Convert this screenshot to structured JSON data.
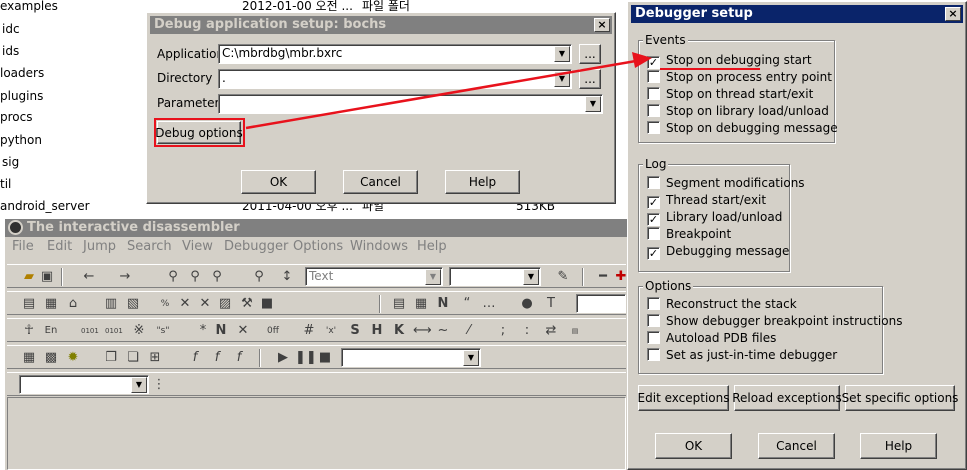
{
  "explorer": {
    "rows": [
      {
        "name": "examples",
        "date": "2012-01-00 오전 ...",
        "type": "파일 폴더",
        "size": ""
      },
      {
        "name": "idc",
        "date": "",
        "type": "",
        "size": ""
      },
      {
        "name": "ids",
        "date": "",
        "type": "",
        "size": ""
      },
      {
        "name": "loaders",
        "date": "",
        "type": "",
        "size": ""
      },
      {
        "name": "plugins",
        "date": "",
        "type": "",
        "size": ""
      },
      {
        "name": "procs",
        "date": "",
        "type": "",
        "size": ""
      },
      {
        "name": "python",
        "date": "",
        "type": "",
        "size": ""
      },
      {
        "name": "sig",
        "date": "",
        "type": "",
        "size": ""
      },
      {
        "name": "til",
        "date": "",
        "type": "",
        "size": ""
      },
      {
        "name": "android_server",
        "date": "2011-04-00 오후 ...",
        "type": "파일",
        "size": "513KB"
      }
    ]
  },
  "debug_app_dialog": {
    "title": "Debug application setup: bochs",
    "close": "×",
    "application_label": "Application",
    "application_value": "C:\\mbrdbg\\mbr.bxrc",
    "directory_label": "Directory",
    "directory_value": ".",
    "parameters_label": "Parameters",
    "parameters_value": "",
    "browse": "...",
    "debug_options": "Debug options",
    "ok": "OK",
    "cancel": "Cancel",
    "help": "Help"
  },
  "debugger_setup": {
    "title": "Debugger setup",
    "close": "×",
    "events": {
      "title": "Events",
      "items": [
        {
          "label": "Stop on debugging start",
          "checked": true
        },
        {
          "label": "Stop on process entry point",
          "checked": false
        },
        {
          "label": "Stop on thread start/exit",
          "checked": false
        },
        {
          "label": "Stop on library load/unload",
          "checked": false
        },
        {
          "label": "Stop on debugging message",
          "checked": false
        }
      ]
    },
    "log": {
      "title": "Log",
      "items": [
        {
          "label": "Segment modifications",
          "checked": false
        },
        {
          "label": "Thread start/exit",
          "checked": true
        },
        {
          "label": "Library load/unload",
          "checked": true
        },
        {
          "label": "Breakpoint",
          "checked": false
        },
        {
          "label": "Debugging message",
          "checked": true
        }
      ]
    },
    "options": {
      "title": "Options",
      "items": [
        {
          "label": "Reconstruct the stack",
          "checked": false
        },
        {
          "label": "Show debugger breakpoint instructions",
          "checked": false
        },
        {
          "label": "Autoload PDB files",
          "checked": false
        },
        {
          "label": "Set as just-in-time debugger",
          "checked": false
        }
      ]
    },
    "edit_exceptions": "Edit exceptions",
    "reload_exceptions": "Reload exceptions",
    "set_specific_options": "Set specific options",
    "ok": "OK",
    "cancel": "Cancel",
    "help": "Help"
  },
  "ida": {
    "title": "The interactive disassembler",
    "menu": [
      "File",
      "Edit",
      "Jump",
      "Search",
      "View",
      "Debugger",
      "Options",
      "Windows",
      "Help"
    ],
    "text_combo": "Text",
    "colors": {
      "arrow": "#e8121c",
      "highlight": "#e8121c",
      "title_active": "#0a246a",
      "title_inactive": "#808080"
    }
  }
}
